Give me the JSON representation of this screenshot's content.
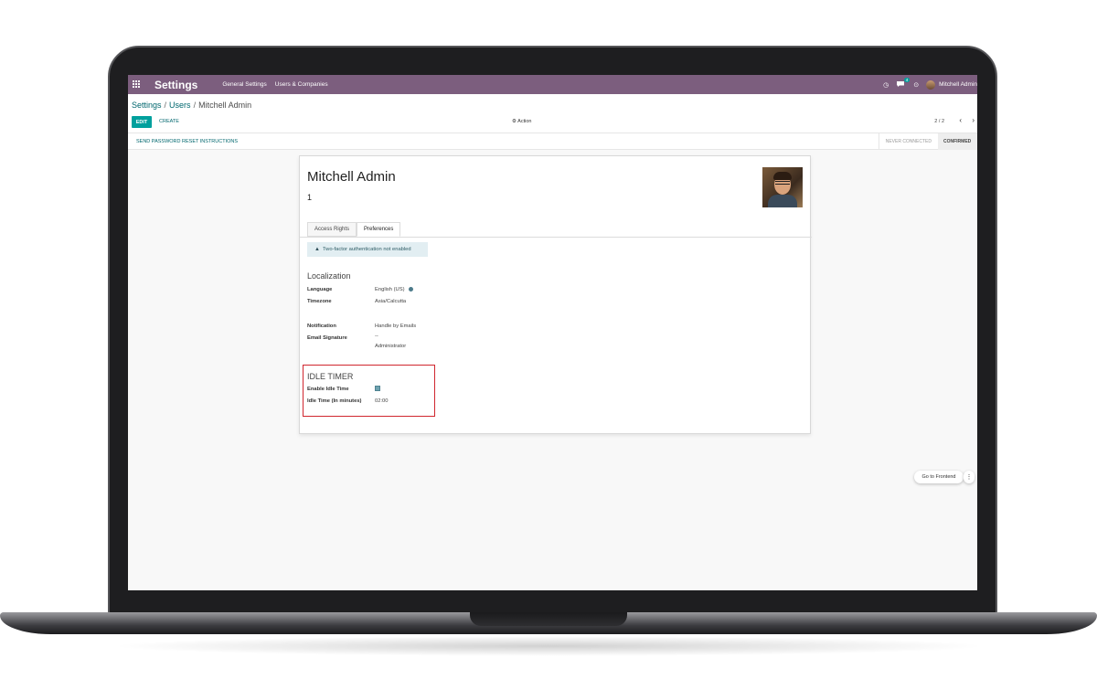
{
  "navbar": {
    "brand": "Settings",
    "menu": [
      "General Settings",
      "Users & Companies"
    ],
    "chat_count": "4",
    "user_name": "Mitchell Admin"
  },
  "breadcrumb": {
    "part1": "Settings",
    "part2": "Users",
    "current": "Mitchell Admin"
  },
  "control": {
    "edit_label": "EDIT",
    "create_label": "CREATE",
    "action_label": "Action",
    "pager": "2 / 2",
    "pager_prev": "‹",
    "pager_next": "›"
  },
  "status": {
    "reset_label": "SEND PASSWORD RESET INSTRUCTIONS",
    "stage_never": "NEVER CONNECTED",
    "stage_confirmed": "CONFIRMED"
  },
  "form": {
    "name": "Mitchell Admin",
    "id": "1",
    "tabs": [
      "Access Rights",
      "Preferences"
    ],
    "alert_2fa": "Two-factor authentication not enabled",
    "localization_title": "Localization",
    "language_label": "Language",
    "language_value": "English (US)",
    "timezone_label": "Timezone",
    "timezone_value": "Asia/Calcutta",
    "notification_label": "Notification",
    "notification_value": "Handle by Emails",
    "signature_label": "Email Signature",
    "signature_line1": "--",
    "signature_line2": "Administrator",
    "idle_title": "IDLE TIMER",
    "idle_enable_label": "Enable Idle Time",
    "idle_enabled": true,
    "idle_time_label": "Idle Time (In minutes)",
    "idle_time_value": "02:00"
  },
  "frontend": {
    "label": "Go to Frontend",
    "more": "⋮"
  },
  "colors": {
    "navbar": "#7c5e7e",
    "primary": "#00a09d",
    "link": "#00676e",
    "highlight": "#d0262e"
  },
  "icons": {
    "apps": "grid-icon",
    "clock": "clock-icon",
    "chat": "chat-icon",
    "activity": "activity-icon",
    "gear": "gear-icon",
    "warning": "warning-icon",
    "globe": "globe-icon"
  }
}
